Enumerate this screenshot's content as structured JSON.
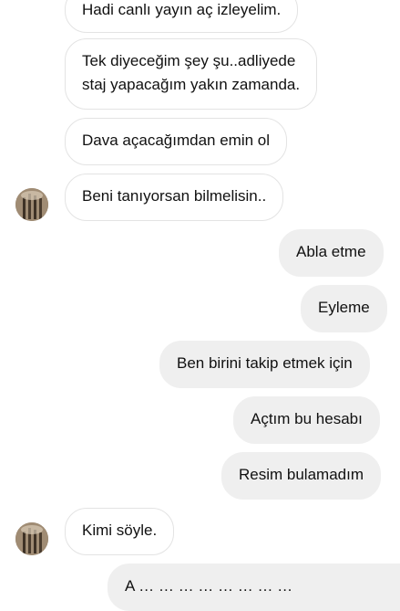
{
  "messages": [
    {
      "side": "incoming",
      "text": "Hadi canlı yayın aç izleyelim."
    },
    {
      "side": "incoming",
      "lines": [
        "Tek diyeceğim şey şu..adliyede",
        "staj yapacağım yakın zamanda."
      ]
    },
    {
      "side": "incoming",
      "text": "Dava açacağımdan emin ol"
    },
    {
      "side": "incoming",
      "text": "Beni tanıyorsan bilmelisin.."
    },
    {
      "side": "outgoing",
      "text": "Abla etme"
    },
    {
      "side": "outgoing",
      "text": "Eyleme"
    },
    {
      "side": "outgoing",
      "text": "Ben birini takip etmek için"
    },
    {
      "side": "outgoing",
      "text": "Açtım bu hesabı"
    },
    {
      "side": "outgoing",
      "text": "Resim bulamadım"
    },
    {
      "side": "incoming",
      "text": "Kimi söyle."
    },
    {
      "side": "outgoing",
      "text": "A … … … … … … … …"
    }
  ],
  "avatar": {
    "icon": "profile-photo-avatar",
    "color": "#8e7a62"
  },
  "colors": {
    "incoming_bg": "#ffffff",
    "incoming_border": "#e3e3e3",
    "outgoing_bg": "#efefef"
  }
}
